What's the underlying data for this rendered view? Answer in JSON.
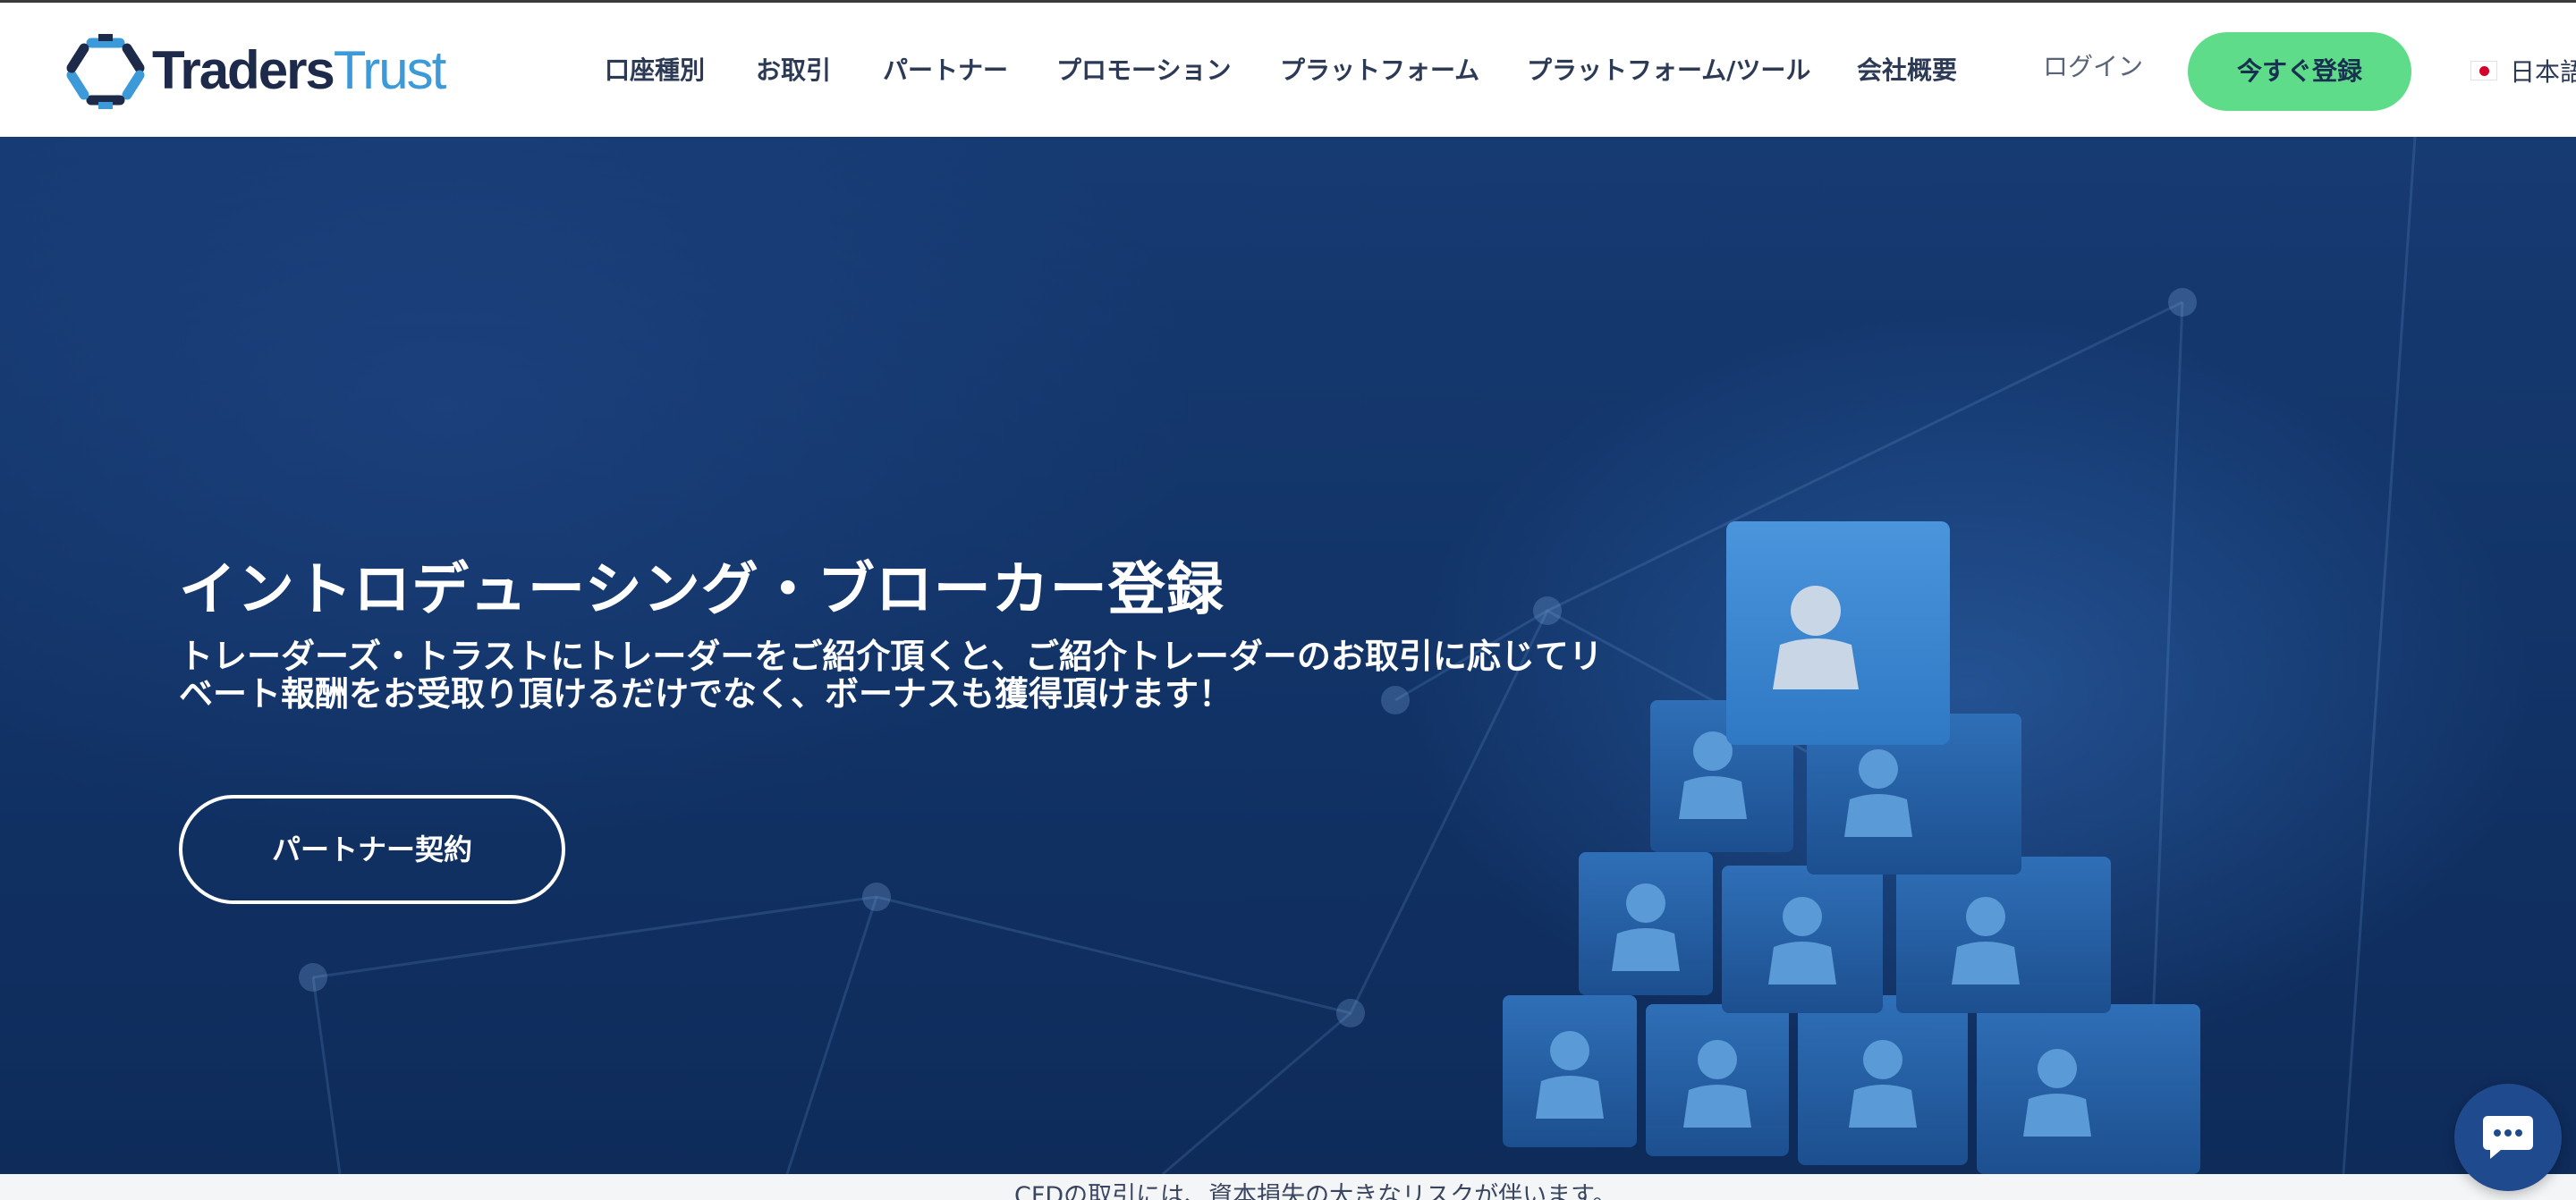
{
  "brand": {
    "name_part1": "Traders",
    "name_part2": "Trust",
    "logo_icon": "hexagon-arrows-logo-icon"
  },
  "nav": {
    "items": [
      {
        "label": "口座種別"
      },
      {
        "label": "お取引"
      },
      {
        "label": "パートナー"
      },
      {
        "label": "プロモーション"
      },
      {
        "label": "プラットフォーム"
      },
      {
        "label": "プラットフォーム/ツール"
      },
      {
        "label": "会社概要"
      }
    ],
    "login_label": "ログイン",
    "signup_label": "今すぐ登録",
    "language_label": "日本語",
    "language_icon": "japan-flag-icon"
  },
  "hero": {
    "title": "イントロデューシング・ブローカー登録",
    "subtitle": "トレーダーズ・トラストにトレーダーをご紹介頂くと、ご紹介トレーダーのお取引に応じてリベート報酬をお受取り頂けるだけでなく、ボーナスも獲得頂けます！",
    "button_label": "パートナー契約",
    "image_icon": "people-cube-pyramid-illustration"
  },
  "risk_notice": {
    "text": "CFDの取引には、資本損失の大きなリスクが伴います。"
  },
  "chat": {
    "icon": "chat-bubble-icon"
  },
  "colors": {
    "brand_dark": "#1d2a4a",
    "brand_light": "#3d9ad8",
    "signup_green": "#5fdc8a",
    "hero_blue": "#123468",
    "chat_blue": "#1f4b8e"
  }
}
